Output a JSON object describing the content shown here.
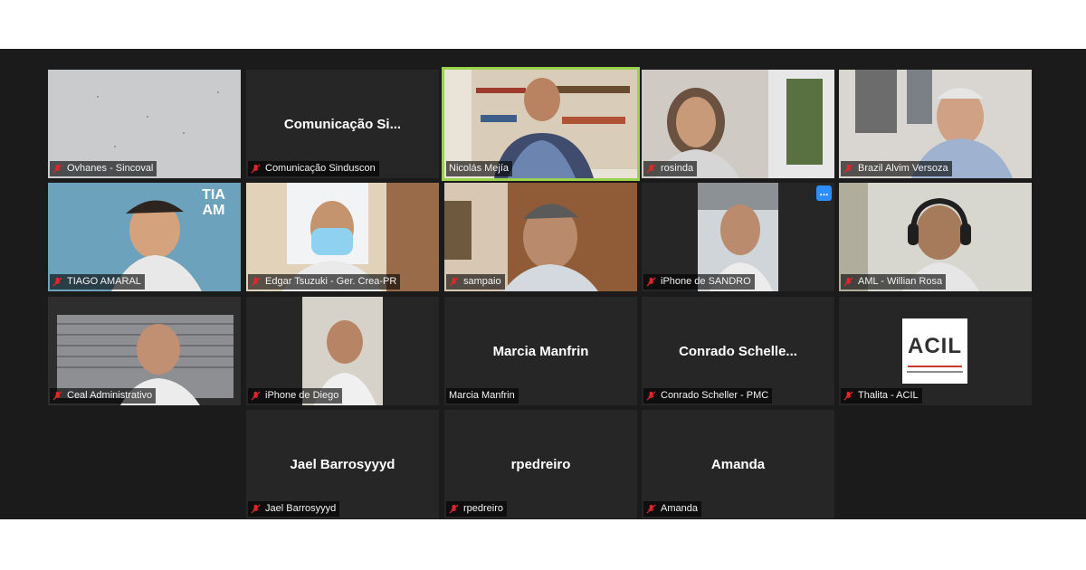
{
  "meeting": {
    "participants": [
      {
        "id": "p1",
        "name": "Ovhanes - Sincoval",
        "muted": true,
        "video": true
      },
      {
        "id": "p2",
        "display": "Comunicação  Si...",
        "name": "Comunicação Sinduscon",
        "muted": true,
        "video": false
      },
      {
        "id": "p3",
        "name": "Nicolás Mejía",
        "muted": false,
        "video": true,
        "active_speaker": true
      },
      {
        "id": "p4",
        "name": "rosinda",
        "muted": true,
        "video": true
      },
      {
        "id": "p5",
        "name": "Brazil Alvim  Versoza",
        "muted": true,
        "video": true
      },
      {
        "id": "p6",
        "name": "TIAGO AMARAL",
        "muted": true,
        "video": true,
        "background_text": "TIA AM"
      },
      {
        "id": "p7",
        "name": "Edgar Tsuzuki - Ger. Crea-PR",
        "muted": true,
        "video": true
      },
      {
        "id": "p8",
        "name": "sampaio",
        "muted": true,
        "video": true
      },
      {
        "id": "p9",
        "name": "iPhone de SANDRO",
        "muted": true,
        "video": true,
        "more_label": "..."
      },
      {
        "id": "p10",
        "name": "AML - Willian Rosa",
        "muted": true,
        "video": true
      },
      {
        "id": "p11",
        "name": "Ceal Administrativo",
        "muted": true,
        "video": true
      },
      {
        "id": "p12",
        "name": "iPhone de Diego",
        "muted": true,
        "video": true
      },
      {
        "id": "p13",
        "display": "Marcia Manfrin",
        "name": "Marcia Manfrin",
        "muted": false,
        "video": false
      },
      {
        "id": "p14",
        "display": "Conrado  Schelle...",
        "name": "Conrado Scheller - PMC",
        "muted": true,
        "video": false
      },
      {
        "id": "p15",
        "name": "Thalita - ACIL",
        "muted": true,
        "video": true,
        "logo_text": "ACIL"
      },
      {
        "id": "p16",
        "display": "Jael Barrosyyyd",
        "name": "Jael Barrosyyyd",
        "muted": true,
        "video": false
      },
      {
        "id": "p17",
        "display": "rpedreiro",
        "name": "rpedreiro",
        "muted": true,
        "video": false
      },
      {
        "id": "p18",
        "display": "Amanda",
        "name": "Amanda",
        "muted": true,
        "video": false
      }
    ]
  },
  "colors": {
    "background": "#1b1b1b",
    "tile": "#262626",
    "active_border": "#9ad24a",
    "mute_icon": "#e0282b",
    "more_button": "#2d8cff"
  },
  "icons": {
    "mute": "mic-off-icon",
    "more": "ellipsis-icon"
  }
}
